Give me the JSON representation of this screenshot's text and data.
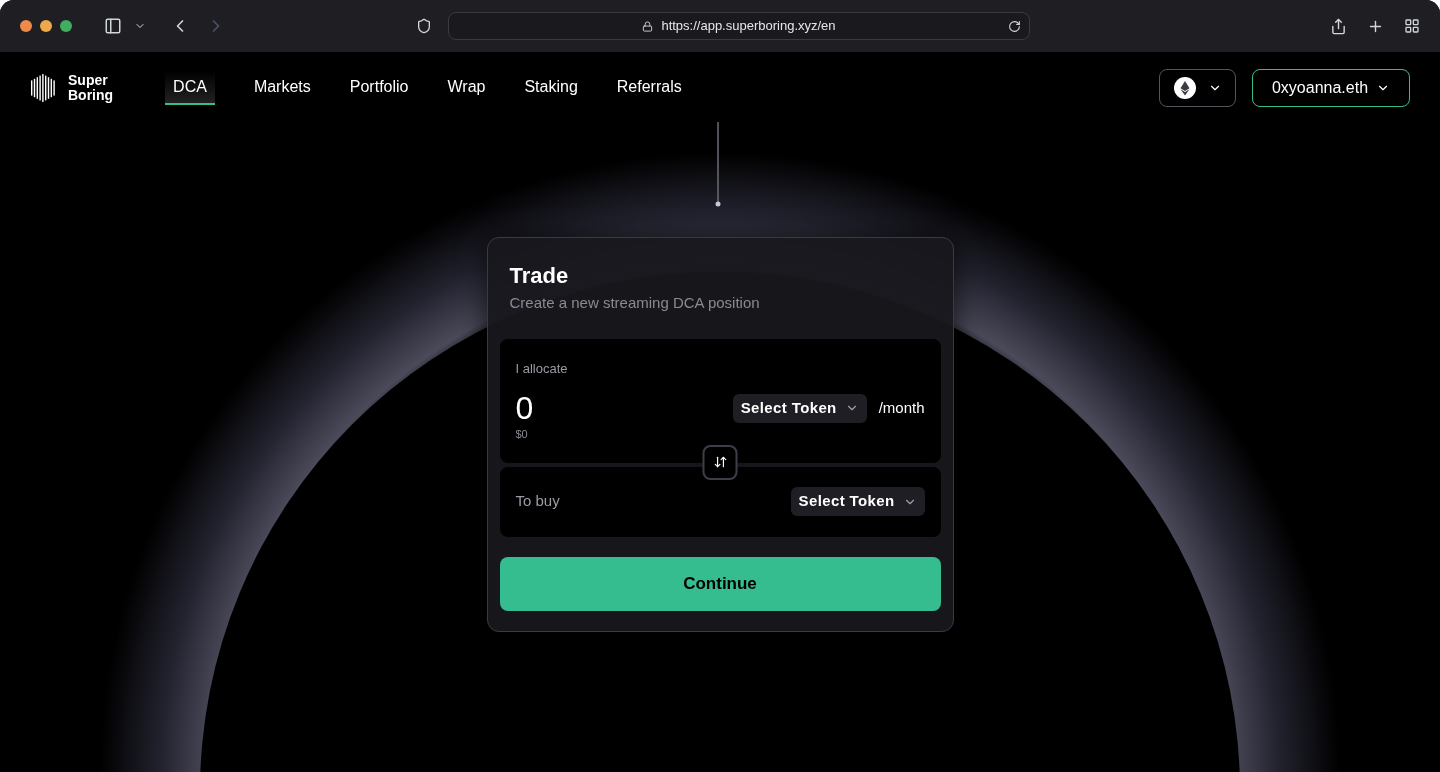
{
  "browser": {
    "url": "https://app.superboring.xyz/en"
  },
  "logo": {
    "line_1": "Super",
    "line_2": "Boring"
  },
  "nav": [
    {
      "label": "DCA",
      "selected": true
    },
    {
      "label": "Markets",
      "selected": false
    },
    {
      "label": "Portfolio",
      "selected": false
    },
    {
      "label": "Wrap",
      "selected": false
    },
    {
      "label": "Staking",
      "selected": false
    },
    {
      "label": "Referrals",
      "selected": false
    }
  ],
  "account": {
    "label": "0xyoanna.eth"
  },
  "card": {
    "title": "Trade",
    "subtitle": "Create a new streaming DCA position",
    "allocate": {
      "label": "I allocate",
      "amount": "0",
      "usd": "$0",
      "token_button": "Select Token",
      "period": "/month"
    },
    "buy": {
      "label": "To buy",
      "token_button": "Select Token"
    },
    "continue": "Continue"
  }
}
